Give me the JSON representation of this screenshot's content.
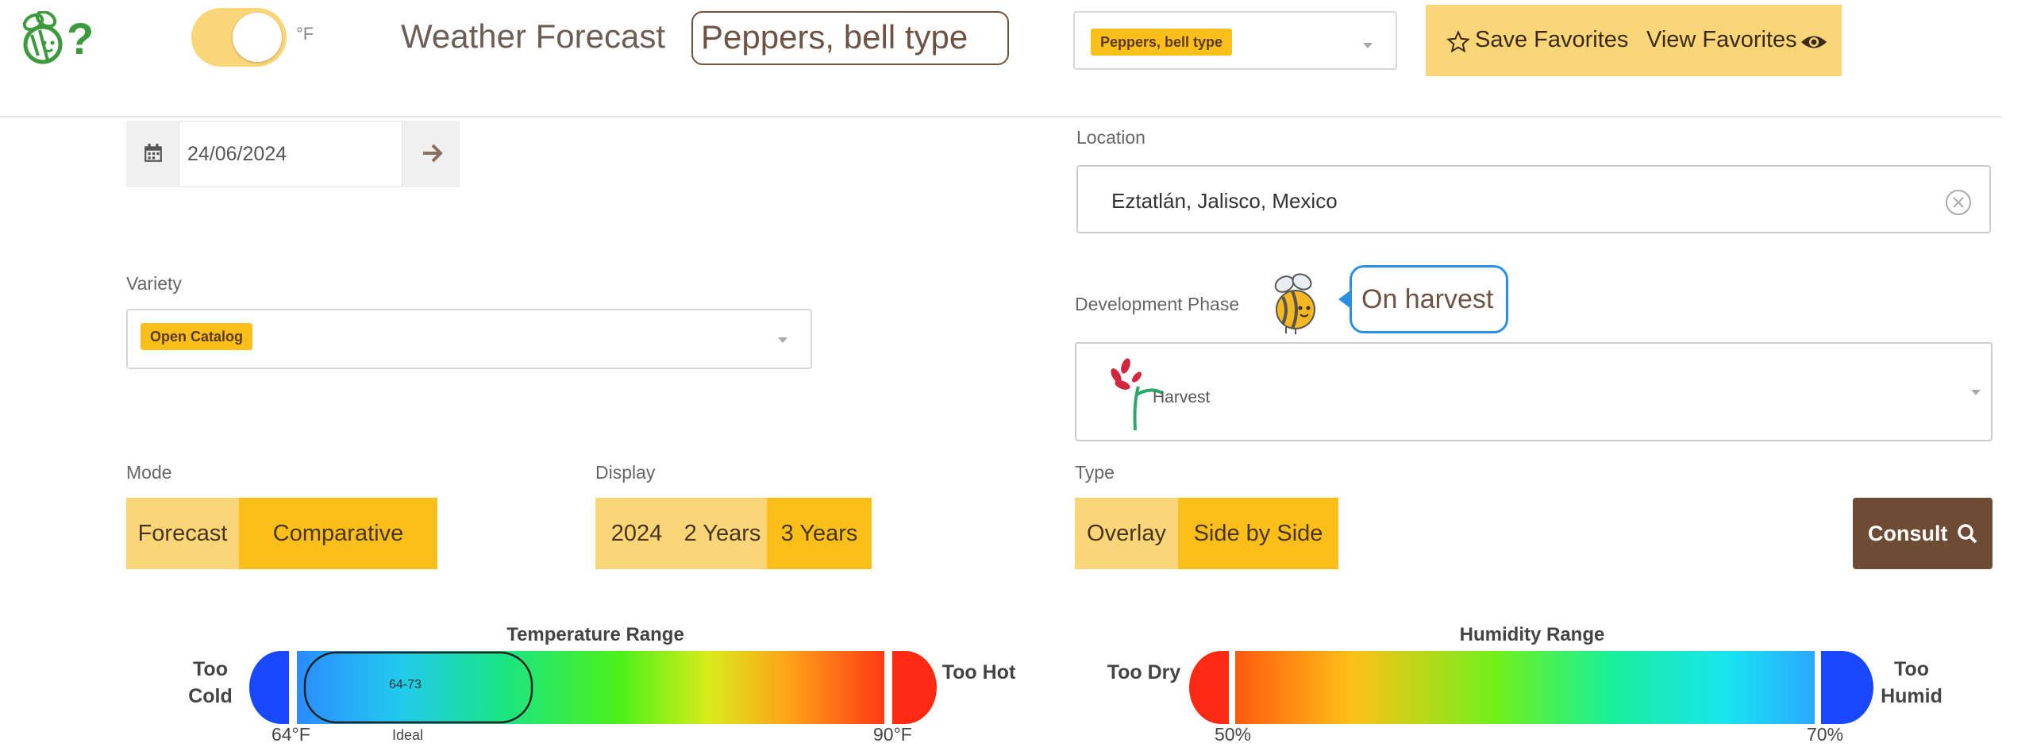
{
  "header": {
    "unit_label": "°F",
    "title": "Weather Forecast",
    "crop_highlight": "Peppers, bell type",
    "crop_select_value": "Peppers, bell type",
    "save_favorites": "Save Favorites",
    "view_favorites": "View Favorites",
    "accent_color": "#fbbf1c",
    "toggle_state": "on"
  },
  "date": {
    "value": "24/06/2024"
  },
  "location": {
    "label": "Location",
    "value": "Eztatlán, Jalisco, Mexico"
  },
  "variety": {
    "label": "Variety",
    "value": "Open Catalog"
  },
  "development_phase": {
    "label": "Development Phase",
    "bubble": "On harvest",
    "value": "Harvest"
  },
  "mode": {
    "label": "Mode",
    "options": [
      "Forecast",
      "Comparative"
    ],
    "selected": "Comparative"
  },
  "display": {
    "label": "Display",
    "options": [
      "2024",
      "2 Years",
      "3 Years"
    ],
    "selected": "3 Years"
  },
  "type": {
    "label": "Type",
    "options": [
      "Overlay",
      "Side by Side"
    ],
    "selected": "Side by Side"
  },
  "consult_button": "Consult",
  "temperature_range": {
    "title": "Temperature Range",
    "too_cold": [
      "Too",
      "Cold"
    ],
    "too_hot": "Too Hot",
    "ideal_value": "64-73",
    "ideal_label": "Ideal",
    "min_label": "64°F",
    "max_label": "90°F"
  },
  "humidity_range": {
    "title": "Humidity Range",
    "too_dry": "Too Dry",
    "too_humid": [
      "Too",
      "Humid"
    ],
    "min_label": "50%",
    "max_label": "70%"
  }
}
